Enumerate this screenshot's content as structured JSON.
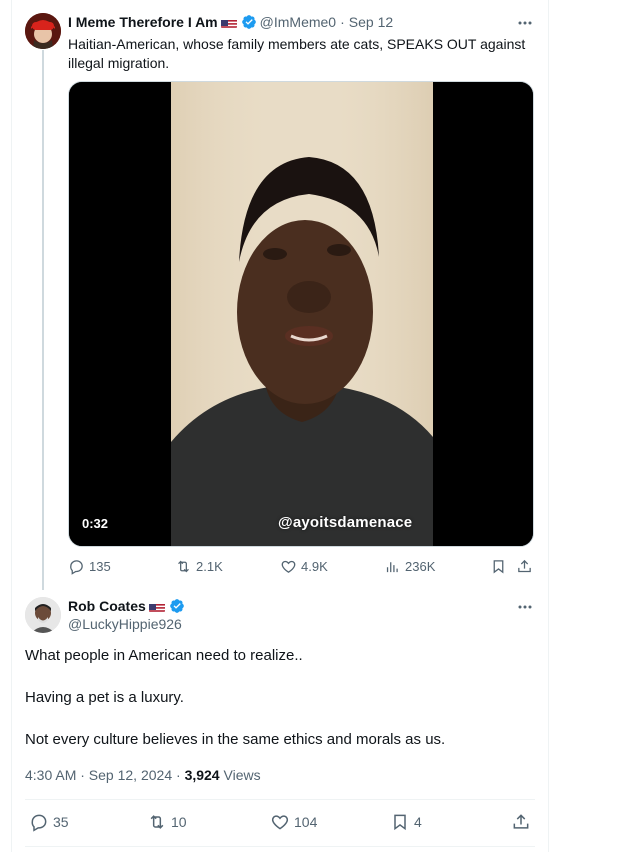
{
  "tweet1": {
    "display_name": "I Meme Therefore I Am",
    "handle": "@ImMeme0",
    "separator": "·",
    "date": "Sep 12",
    "text": "Haitian-American, whose family members ate cats, SPEAKS OUT against illegal migration.",
    "video": {
      "duration": "0:32",
      "watermark": "@ayoitsdamenace"
    },
    "actions": {
      "replies": "135",
      "reposts": "2.1K",
      "likes": "4.9K",
      "views": "236K"
    }
  },
  "tweet2": {
    "display_name": "Rob Coates",
    "handle": "@LuckyHippie926",
    "paragraphs": [
      "What people in American need to realize..",
      "Having a pet is a luxury.",
      "Not every culture believes in the same ethics and morals as us."
    ],
    "timestamp": "4:30 AM · Sep 12, 2024",
    "dot": "·",
    "views_count": "3,924",
    "views_label": "Views",
    "actions": {
      "replies": "35",
      "reposts": "10",
      "likes": "104",
      "bookmarks": "4"
    }
  },
  "colors": {
    "verified": "#1d9bf0",
    "muted": "#536471",
    "text": "#0f1419",
    "border": "#eff3f4"
  }
}
